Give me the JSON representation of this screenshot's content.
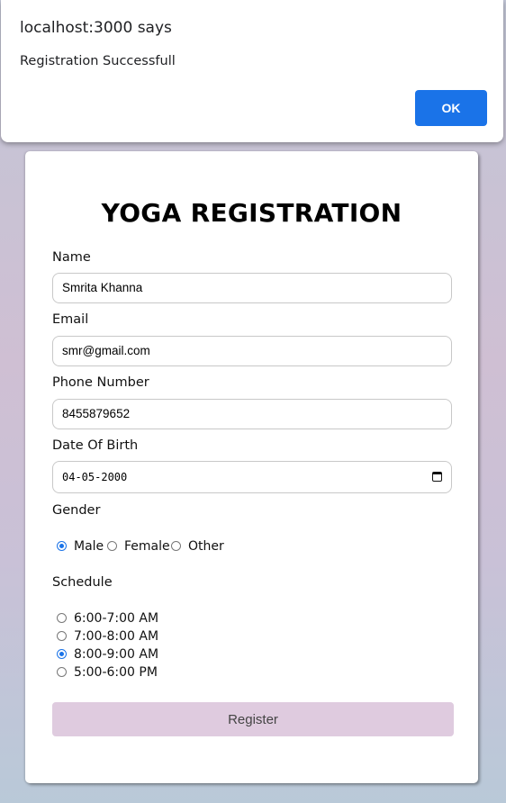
{
  "alert": {
    "origin": "localhost:3000 says",
    "message": "Registration Successfull",
    "ok_label": "OK"
  },
  "form": {
    "title": "YOGA REGISTRATION",
    "name_label": "Name",
    "name_value": "Smrita Khanna",
    "email_label": "Email",
    "email_value": "smr@gmail.com",
    "phone_label": "Phone Number",
    "phone_value": "8455879652",
    "dob_label": "Date Of Birth",
    "dob_value": "04-05-2000",
    "gender_label": "Gender",
    "gender_options": [
      "Male",
      "Female",
      "Other"
    ],
    "gender_selected": "Male",
    "schedule_label": "Schedule",
    "schedule_options": [
      "6:00-7:00 AM",
      "7:00-8:00 AM",
      "8:00-9:00 AM",
      "5:00-6:00 PM"
    ],
    "schedule_selected": "8:00-9:00 AM",
    "register_label": "Register"
  },
  "colors": {
    "accent": "#1a73e8",
    "register_button": "#dfcbdf"
  }
}
